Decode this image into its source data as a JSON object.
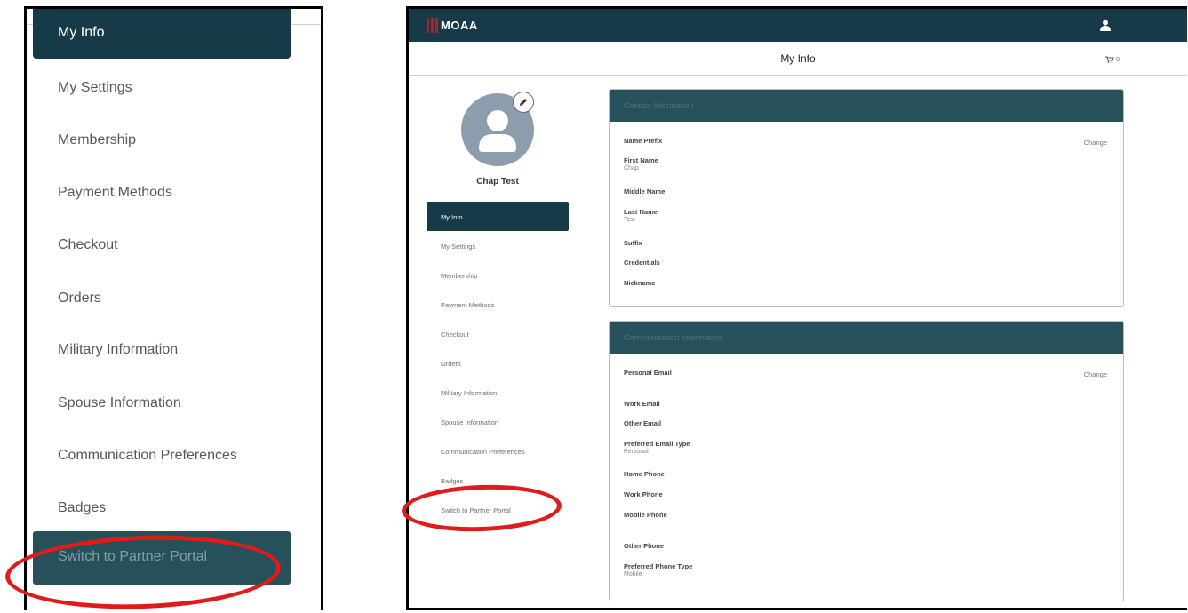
{
  "zoom_nav": {
    "items": [
      {
        "label": "My Info"
      },
      {
        "label": "My Settings"
      },
      {
        "label": "Membership"
      },
      {
        "label": "Payment Methods"
      },
      {
        "label": "Checkout"
      },
      {
        "label": "Orders"
      },
      {
        "label": "Military Information"
      },
      {
        "label": "Spouse Information"
      },
      {
        "label": "Communication Preferences"
      },
      {
        "label": "Badges"
      },
      {
        "label": "Switch to Partner Portal"
      }
    ]
  },
  "app": {
    "logo_text": "MOAA",
    "page_title": "My Info",
    "cart_count": "0",
    "profile_name": "Chap Test",
    "nav": [
      {
        "label": "My Info"
      },
      {
        "label": "My Settings"
      },
      {
        "label": "Membership"
      },
      {
        "label": "Payment Methods"
      },
      {
        "label": "Checkout"
      },
      {
        "label": "Orders"
      },
      {
        "label": "Military Information"
      },
      {
        "label": "Spouse Information"
      },
      {
        "label": "Communication Preferences"
      },
      {
        "label": "Badges"
      },
      {
        "label": "Switch to Partner Portal"
      }
    ],
    "contact": {
      "title": "Contact Information",
      "change_label": "Change",
      "fields": [
        {
          "label": "Name Prefix",
          "value": ""
        },
        {
          "label": "First Name",
          "value": "Chap"
        },
        {
          "label": "Middle Name",
          "value": ""
        },
        {
          "label": "Last Name",
          "value": "Test"
        },
        {
          "label": "Suffix",
          "value": ""
        },
        {
          "label": "Credentials",
          "value": ""
        },
        {
          "label": "Nickname",
          "value": ""
        }
      ]
    },
    "communication": {
      "title": "Communication Information",
      "change_label": "Change",
      "fields": [
        {
          "label": "Personal Email",
          "value": ""
        },
        {
          "label": "Work Email",
          "value": ""
        },
        {
          "label": "Other Email",
          "value": ""
        },
        {
          "label": "Preferred Email Type",
          "value": "Personal"
        },
        {
          "label": "Home Phone",
          "value": ""
        },
        {
          "label": "Work Phone",
          "value": ""
        },
        {
          "label": "Mobile Phone",
          "value": ""
        },
        {
          "label": "Other Phone",
          "value": ""
        },
        {
          "label": "Preferred Phone Type",
          "value": "Mobile"
        }
      ]
    }
  },
  "colors": {
    "brand_dark": "#173a48",
    "card_header": "#26515b",
    "logo_red": "#b21f24",
    "annotation_red": "#e01b1b"
  },
  "icons": {
    "user": "user-icon",
    "cart": "cart-icon",
    "edit": "pencil-icon",
    "avatar": "person-avatar-icon"
  }
}
